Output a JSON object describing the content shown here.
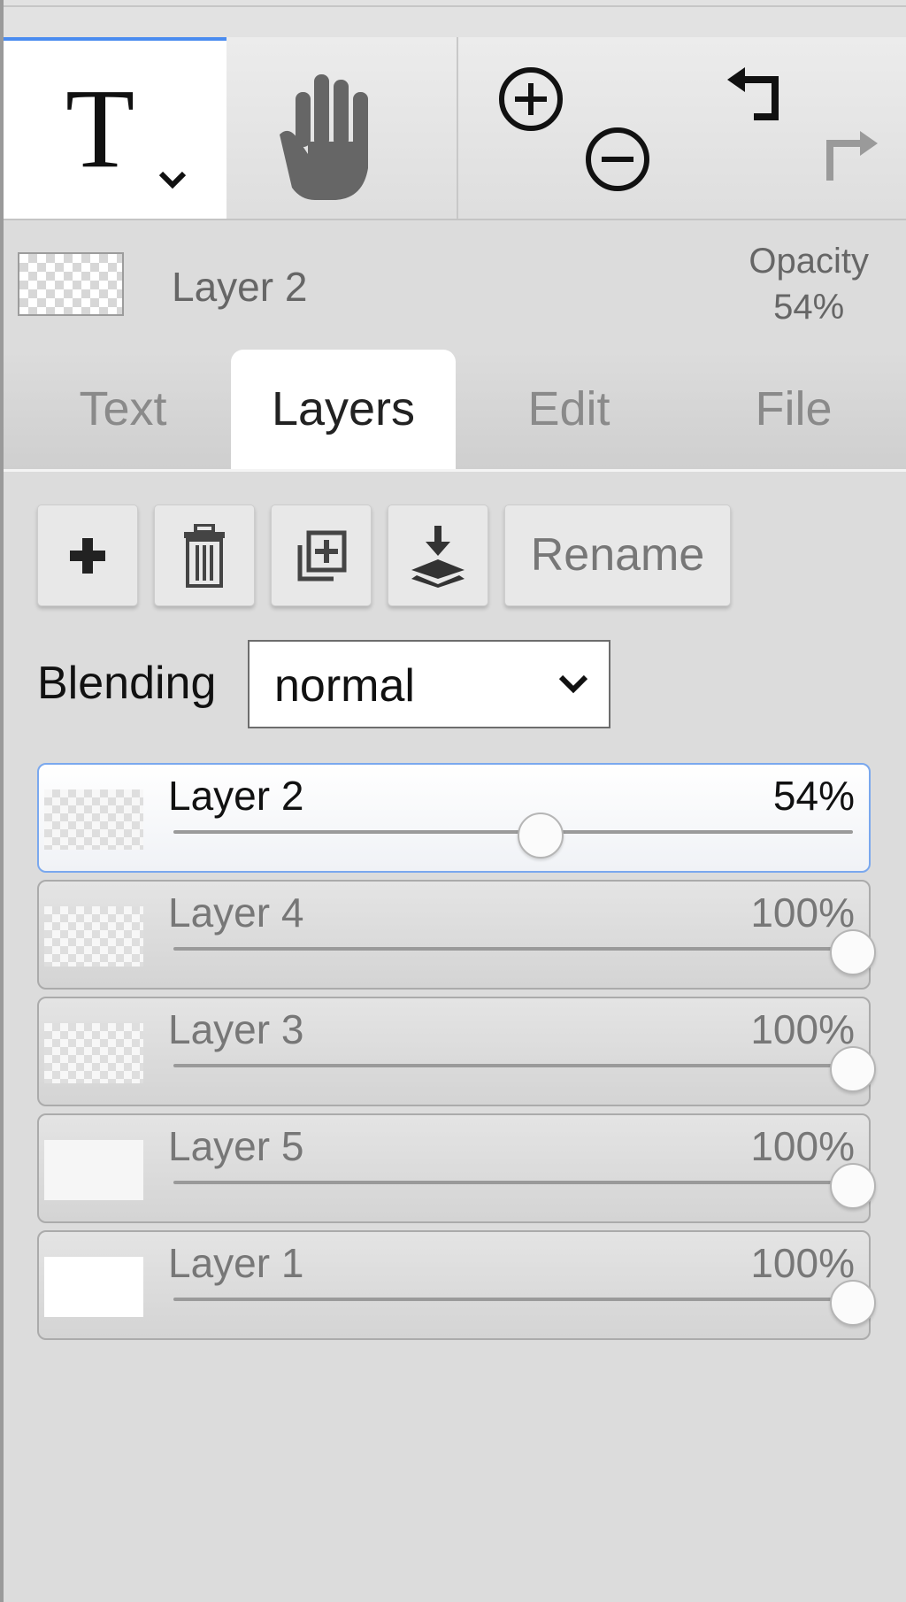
{
  "toolbar": {
    "tools": [
      {
        "id": "text-tool",
        "icon": "text-tool-icon",
        "selected": true
      },
      {
        "id": "hand-tool",
        "icon": "hand-icon"
      },
      {
        "id": "zoom-in",
        "icon": "zoom-in-icon"
      },
      {
        "id": "zoom-out",
        "icon": "zoom-out-icon"
      },
      {
        "id": "undo",
        "icon": "undo-icon"
      },
      {
        "id": "redo",
        "icon": "redo-icon",
        "disabled": true
      }
    ],
    "accent_color": "#4a8cf0"
  },
  "current_layer": {
    "name": "Layer 2",
    "opacity_label": "Opacity",
    "opacity_value": "54%"
  },
  "tabs": [
    {
      "label": "Text",
      "active": false
    },
    {
      "label": "Layers",
      "active": true
    },
    {
      "label": "Edit",
      "active": false
    },
    {
      "label": "File",
      "active": false
    }
  ],
  "layer_actions": {
    "add_icon": "plus-icon",
    "delete_icon": "trash-icon",
    "duplicate_icon": "duplicate-icon",
    "merge_down_icon": "merge-down-icon",
    "rename_label": "Rename"
  },
  "blending": {
    "label": "Blending",
    "value": "normal"
  },
  "layers": [
    {
      "name": "Layer 2",
      "opacity": "54%",
      "opacity_fraction": 0.54,
      "active": true
    },
    {
      "name": "Layer 4",
      "opacity": "100%",
      "opacity_fraction": 1.0,
      "active": false
    },
    {
      "name": "Layer 3",
      "opacity": "100%",
      "opacity_fraction": 1.0,
      "active": false
    },
    {
      "name": "Layer 5",
      "opacity": "100%",
      "opacity_fraction": 1.0,
      "active": false
    },
    {
      "name": "Layer 1",
      "opacity": "100%",
      "opacity_fraction": 1.0,
      "active": false
    }
  ]
}
